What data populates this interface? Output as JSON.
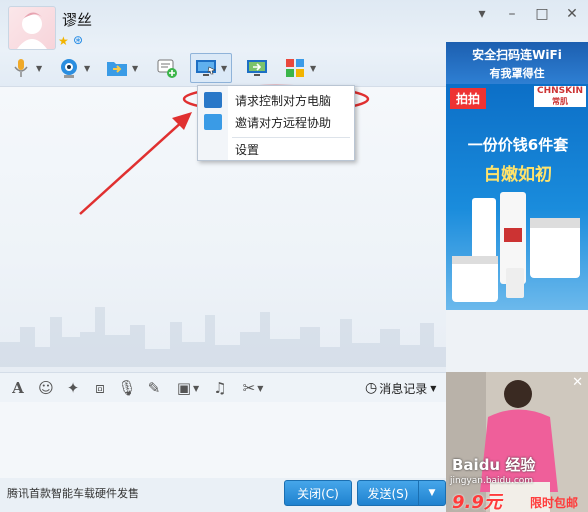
{
  "contact": {
    "name": "谬丝"
  },
  "menu": {
    "items": [
      {
        "label": "请求控制对方电脑"
      },
      {
        "label": "邀请对方远程协助"
      },
      {
        "label": "设置"
      }
    ]
  },
  "input_toolbar": {
    "history_label": "消息记录"
  },
  "bottom": {
    "tip": "腾讯首款智能车载硬件发售",
    "close_label": "关闭(C)",
    "send_label": "发送(S)"
  },
  "ads": {
    "top_line1": "安全扫码连WiFi",
    "top_line2": "有我罩得住",
    "side_tag": "拍拍",
    "side_brand": "CHNSKIN",
    "side_brand_sub": "常肌",
    "side_headline": "一份价钱6件套",
    "side_slogan": "白嫩如初",
    "bottom_price": "9.9元",
    "bottom_tag": "限时包邮",
    "watermark": "Baidu 经验",
    "watermark_sub": "jingyan.baidu.com"
  },
  "colors": {
    "accent": "#1f82cf",
    "annotation": "#e03030"
  }
}
